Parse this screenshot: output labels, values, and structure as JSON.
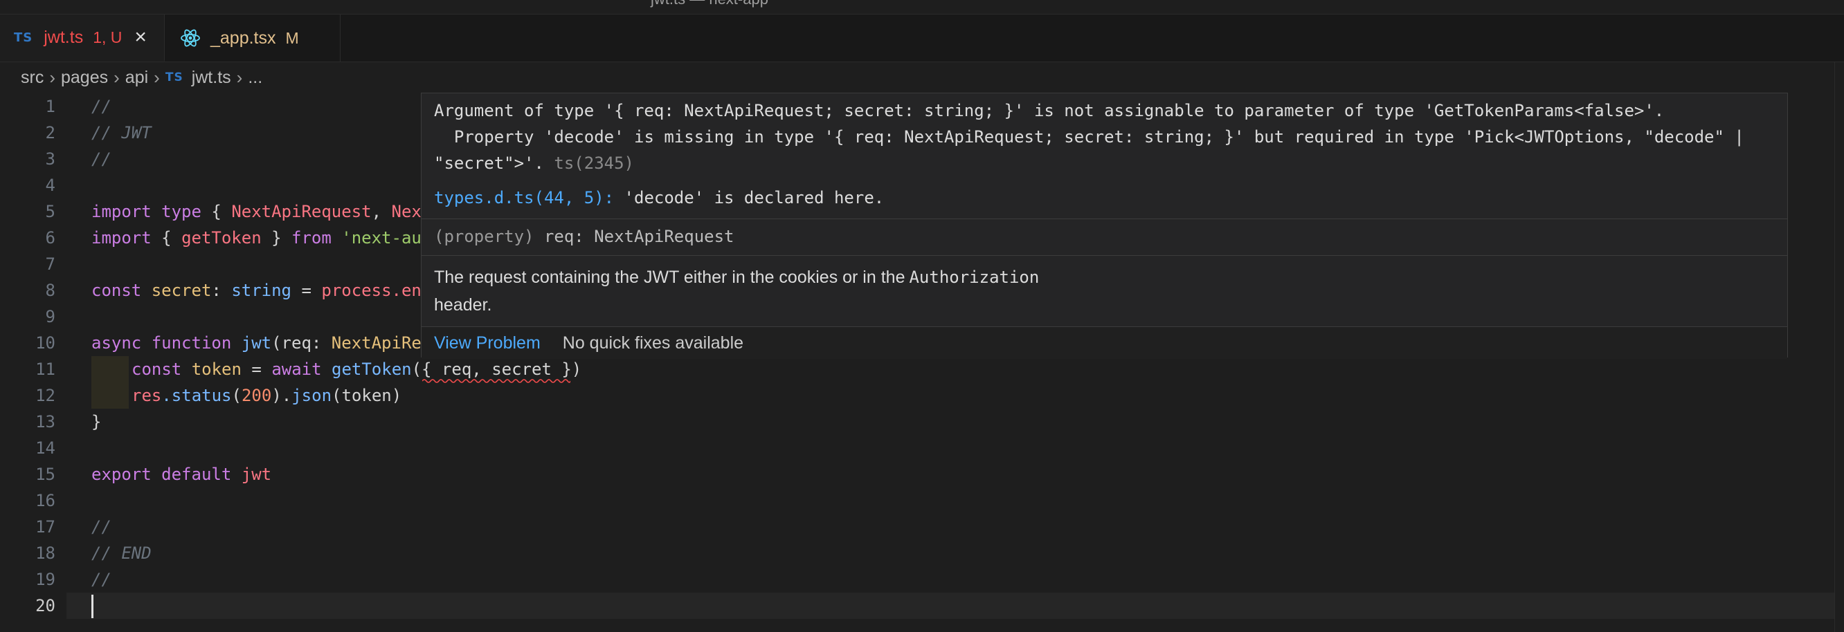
{
  "window": {
    "title": "jwt.ts — next-app"
  },
  "tabs": [
    {
      "icon": "typescript-icon",
      "badge": "TS",
      "name": "jwt.ts",
      "status": "1, U",
      "close": "×"
    },
    {
      "icon": "react-icon",
      "name": "_app.tsx",
      "status": "M"
    }
  ],
  "breadcrumb": {
    "parts": [
      "src",
      "pages",
      "api"
    ],
    "file_badge": "TS",
    "file": "jwt.ts",
    "more": "..."
  },
  "editor": {
    "current_line": 20,
    "line_numbers": [
      "1",
      "2",
      "3",
      "4",
      "5",
      "6",
      "7",
      "8",
      "9",
      "10",
      "11",
      "12",
      "13",
      "14",
      "15",
      "16",
      "17",
      "18",
      "19",
      "20"
    ],
    "lines": {
      "l1": "//",
      "l2": "// JWT",
      "l3": "//",
      "l5_a": "import",
      "l5_b": " type",
      "l5_c": " { ",
      "l5_d": "NextApiRequest",
      "l5_e": ", ",
      "l5_f": "Nex",
      "l6_a": "import",
      "l6_b": " { ",
      "l6_c": "getToken",
      "l6_d": " } ",
      "l6_e": "from",
      "l6_f": " 'next-au",
      "l8_a": "const",
      "l8_b": " secret",
      "l8_c": ": ",
      "l8_d": "string",
      "l8_e": " = ",
      "l8_f": "process",
      "l8_g": ".en",
      "l10_a": "async",
      "l10_b": " function",
      "l10_c": " jwt",
      "l10_d": "(req: ",
      "l10_e": "NextApiRe",
      "l11_a": "const",
      "l11_b": " token",
      "l11_c": " = ",
      "l11_d": "await",
      "l11_e": " getToken",
      "l11_f": "({ req, secret })",
      "l12_a": "res",
      "l12_b": ".status",
      "l12_c": "(",
      "l12_d": "200",
      "l12_e": ").",
      "l12_f": "json",
      "l12_g": "(token)",
      "l13": "}",
      "l15_a": "export",
      "l15_b": " default",
      "l15_c": " jwt",
      "l17": "//",
      "l18": "// END",
      "l19": "//"
    }
  },
  "hover": {
    "error_line1": "Argument of type '{ req: NextApiRequest; secret: string; }' is not assignable to parameter of type 'GetTokenParams<false>'.",
    "error_line2": "  Property 'decode' is missing in type '{ req: NextApiRequest; secret: string; }' but required in type 'Pick<JWTOptions, \"decode\" |",
    "error_line3": "\"secret\">'.",
    "error_code": " ts(2345)",
    "decl_link": "types.d.ts(44, 5):",
    "decl_text": " 'decode' is declared here.",
    "sig_kind": "(property)",
    "sig_rest": " req: NextApiRequest",
    "doc_part1": "The request containing the JWT either in the cookies or in the",
    "doc_code": "Authorization",
    "doc_part2": "header.",
    "view_problem": "View Problem",
    "no_fixes": "No quick fixes available"
  }
}
